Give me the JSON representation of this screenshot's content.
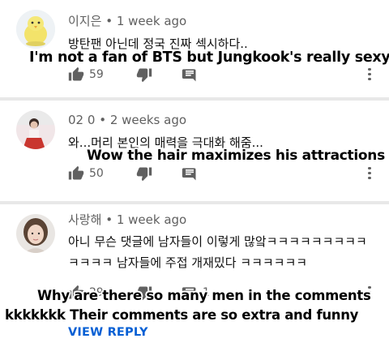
{
  "comments": [
    {
      "author": "이지은",
      "time": "1 week ago",
      "text": "방탄팬 아닌데 정국 진짜 섹시하다..",
      "caption": "I'm not a fan of BTS but Jungkook's really sexy",
      "likes": "59",
      "avatar_icon": "chick-avatar-icon"
    },
    {
      "author": "02 0",
      "time": "2 weeks ago",
      "text": "와...머리 본인의 매력을 극대화 해줌...",
      "caption": "Wow the hair maximizes his attractions",
      "likes": "50",
      "avatar_icon": "person-avatar-icon"
    },
    {
      "author": "사랑해",
      "time": "1 week ago",
      "text_line1": "아니 무슨 댓글에 남자들이 이렇게 많앜ㅋㅋㅋㅋㅋㅋㅋㅋㅋ",
      "text_line2": "ㅋㅋㅋㅋ 남자들에 주접 개재밌다 ㅋㅋㅋㅋㅋㅋ",
      "caption_line1": "Why are there so many men in the comments",
      "caption_line2": "kkkkkkk Their comments are so extra and funny",
      "likes": "29",
      "replies": "1",
      "avatar_icon": "girl-avatar-icon",
      "view_reply": "VIEW REPLY"
    }
  ],
  "separator": "•"
}
